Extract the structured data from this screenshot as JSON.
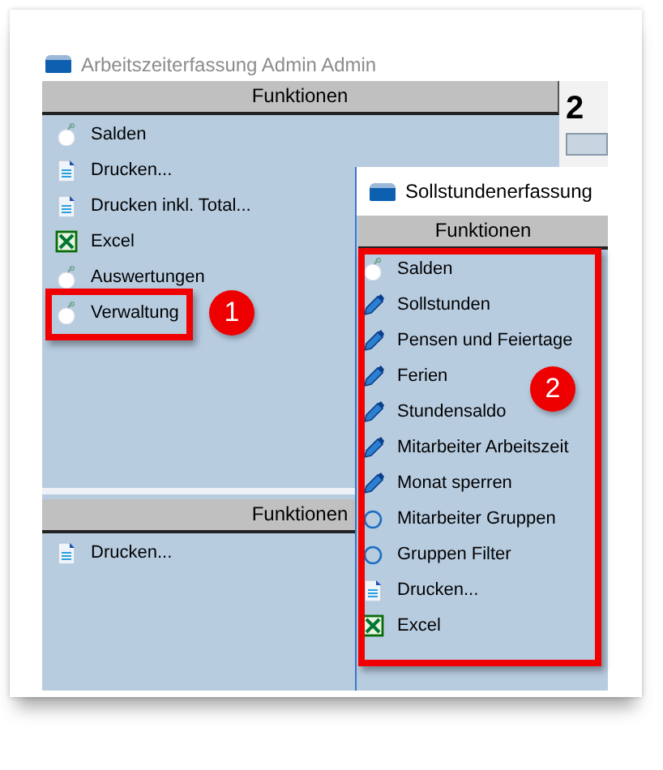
{
  "window": {
    "title": "Arbeitszeiterfassung Admin Admin"
  },
  "main_panel": {
    "header": "Funktionen",
    "items": [
      {
        "label": "Salden",
        "kind": "ball"
      },
      {
        "label": "Drucken...",
        "kind": "document"
      },
      {
        "label": "Drucken inkl. Total...",
        "kind": "document"
      },
      {
        "label": "Excel",
        "kind": "excel"
      },
      {
        "label": "Auswertungen",
        "kind": "ball"
      },
      {
        "label": "Verwaltung",
        "kind": "ball"
      }
    ]
  },
  "lower_panel": {
    "header": "Funktionen",
    "items": [
      {
        "label": "Drucken...",
        "kind": "document"
      }
    ]
  },
  "side_strip": {
    "number": "2"
  },
  "dialog": {
    "title": "Sollstundenerfassung",
    "header": "Funktionen",
    "items": [
      {
        "label": "Salden",
        "kind": "ball"
      },
      {
        "label": "Sollstunden",
        "kind": "pencil"
      },
      {
        "label": "Pensen und Feiertage",
        "kind": "pencil"
      },
      {
        "label": "Ferien",
        "kind": "pencil"
      },
      {
        "label": "Stundensaldo",
        "kind": "pencil"
      },
      {
        "label": "Mitarbeiter Arbeitszeit",
        "kind": "pencil"
      },
      {
        "label": "Monat sperren",
        "kind": "pencil"
      },
      {
        "label": "Mitarbeiter Gruppen",
        "kind": "ring"
      },
      {
        "label": "Gruppen Filter",
        "kind": "ring"
      },
      {
        "label": "Drucken...",
        "kind": "document"
      },
      {
        "label": "Excel",
        "kind": "excel"
      }
    ]
  },
  "callouts": [
    {
      "number": "1"
    },
    {
      "number": "2"
    }
  ]
}
